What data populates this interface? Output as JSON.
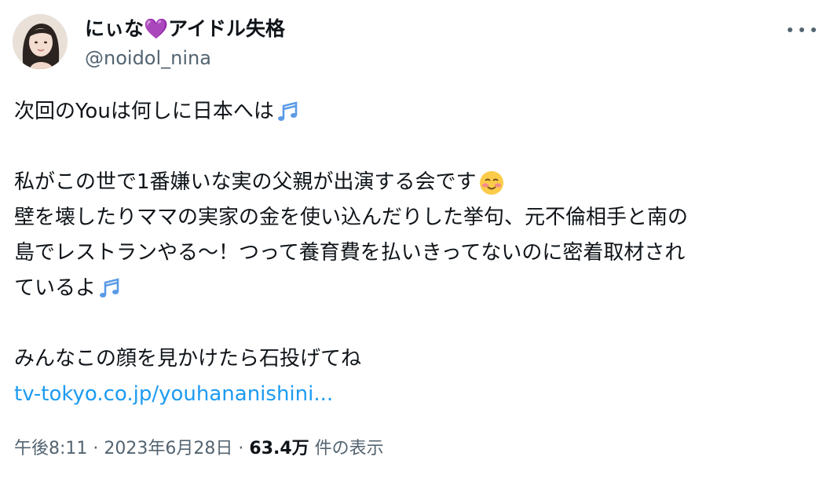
{
  "author": {
    "display_name": "にぃな💜アイドル失格",
    "handle": "@noidol_nina"
  },
  "icons": {
    "more": "more-horizontal-icon",
    "music": "musical-notes-icon",
    "smile": "smiling-face-blush-icon",
    "heart": "purple-heart-icon"
  },
  "colors": {
    "link": "#1d9bf0",
    "secondary_text": "#536471",
    "heart": "#a78bfa",
    "note": "#5b9be6"
  },
  "body": {
    "line1": "次回のYouは何しに日本へは",
    "line2": "私がこの世で1番嫌いな実の父親が出演する会です",
    "line3": "壁を壊したりママの実家の金を使い込んだりした挙句、元不倫相手と南の",
    "line4": "島でレストランやる〜！つって養育費を払いきってないのに密着取材され",
    "line5": "ているよ",
    "line6": "みんなこの顔を見かけたら石投げてね",
    "link": "tv-tokyo.co.jp/youhananishini..."
  },
  "meta": {
    "time": "午後8:11",
    "separator": "·",
    "date": "2023年6月28日",
    "views_count": "63.4万",
    "views_label": "件の表示"
  }
}
